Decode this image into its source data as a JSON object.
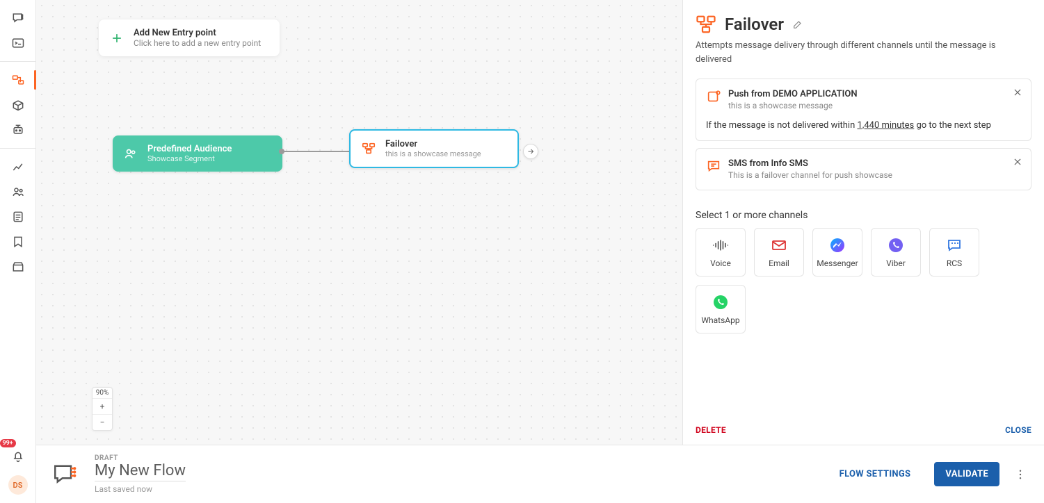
{
  "rail": {
    "notification_badge": "99+",
    "avatar_initials": "DS"
  },
  "canvas": {
    "add_entry": {
      "title": "Add New Entry point",
      "subtitle": "Click here to add a new entry point"
    },
    "audience_node": {
      "title": "Predefined Audience",
      "subtitle": "Showcase Segment"
    },
    "failover_node": {
      "title": "Failover",
      "subtitle": "this is a showcase message"
    },
    "zoom": {
      "level": "90%"
    }
  },
  "panel": {
    "title": "Failover",
    "description": "Attempts message delivery through different channels until the message is delivered",
    "steps": [
      {
        "title": "Push from DEMO APPLICATION",
        "subtitle": "this is a showcase message",
        "rule_prefix": "If the message is not delivered within ",
        "rule_value": "1,440 minutes",
        "rule_suffix": " go to the next step"
      },
      {
        "title": "SMS from Info SMS",
        "subtitle": "This is a failover channel for push showcase"
      }
    ],
    "channels_label": "Select 1 or more channels",
    "channels": [
      "Voice",
      "Email",
      "Messenger",
      "Viber",
      "RCS",
      "WhatsApp"
    ],
    "delete_label": "DELETE",
    "close_label": "CLOSE"
  },
  "bottom": {
    "kicker": "DRAFT",
    "name": "My New Flow",
    "saved": "Last saved now",
    "flow_settings": "FLOW SETTINGS",
    "validate": "VALIDATE"
  }
}
